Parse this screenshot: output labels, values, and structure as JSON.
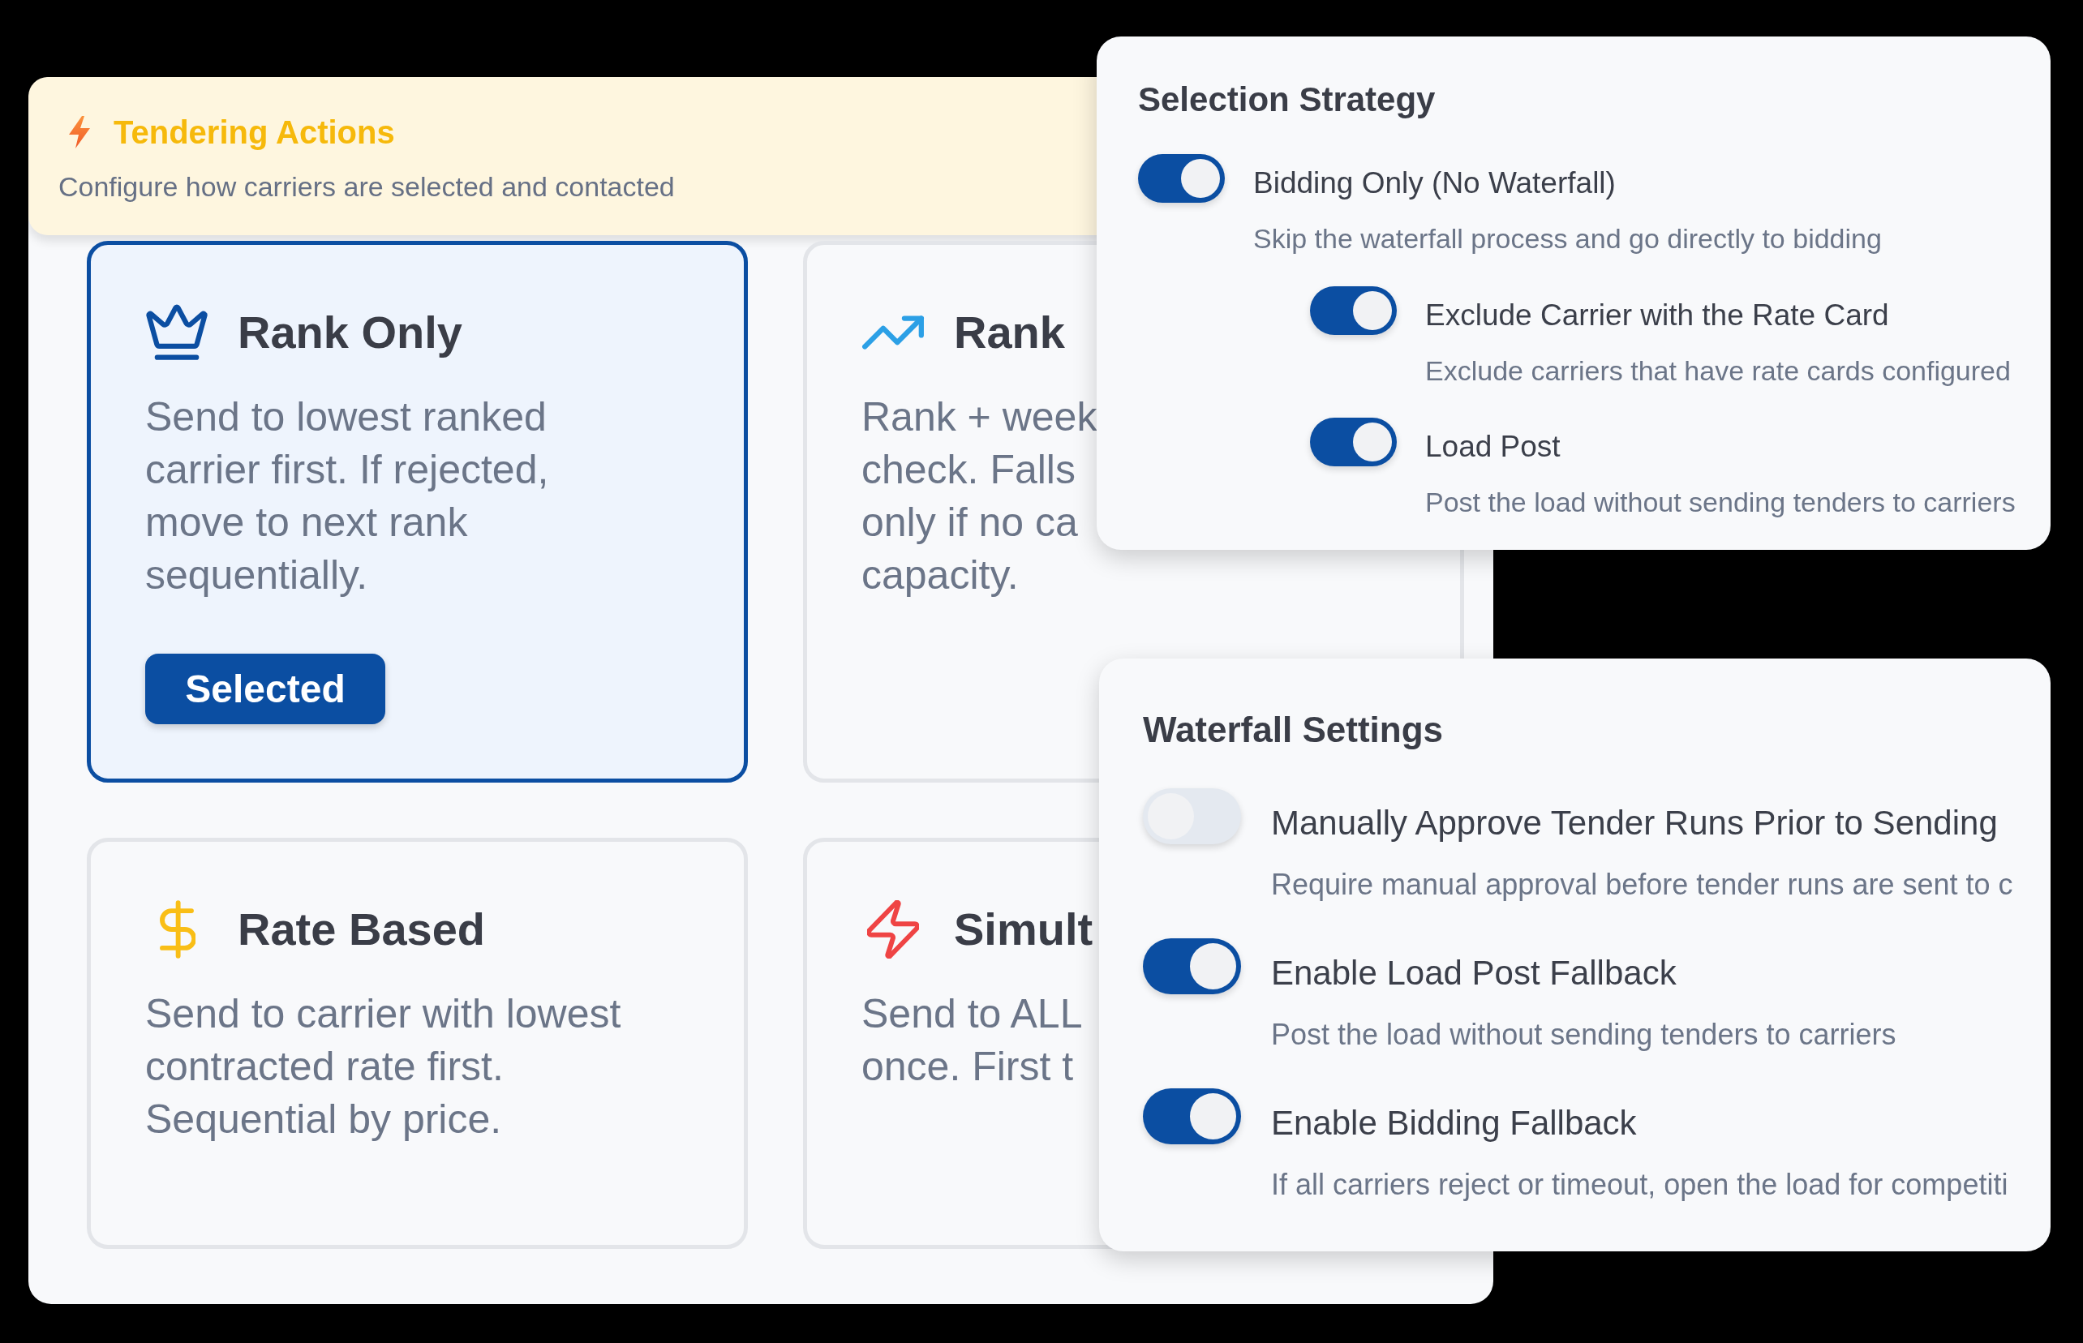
{
  "header": {
    "title": "Tendering Actions",
    "subtitle": "Configure how carriers are selected and contacted"
  },
  "strategy_cards": [
    {
      "title": "Rank Only",
      "description_lines": [
        "Send to lowest ranked",
        "carrier first. If rejected,",
        "move to next rank",
        "sequentially."
      ],
      "selected": true,
      "button": "Selected"
    },
    {
      "title": "Rank",
      "description_lines": [
        "Rank + week",
        "check. Falls",
        "only if no ca",
        "capacity."
      ],
      "selected": false
    },
    {
      "title": "Rate Based",
      "description_lines": [
        "Send to carrier with lowest",
        "contracted rate first.",
        "Sequential by price."
      ],
      "selected": false
    },
    {
      "title": "Simult",
      "description_lines": [
        "Send to ALL",
        "once. First t"
      ],
      "selected": false
    }
  ],
  "selection_strategy": {
    "title": "Selection Strategy",
    "options": [
      {
        "label": "Bidding Only (No Waterfall)",
        "description": "Skip the waterfall process and go directly to bidding",
        "on": true,
        "children": [
          {
            "label": "Exclude Carrier with the Rate Card",
            "description": "Exclude carriers that have rate cards configured",
            "on": true
          },
          {
            "label": "Load Post",
            "description": "Post the load without sending tenders to carriers",
            "on": true
          }
        ]
      }
    ]
  },
  "waterfall_settings": {
    "title": "Waterfall Settings",
    "options": [
      {
        "label": "Manually Approve Tender Runs Prior to Sending",
        "description": "Require manual approval before tender runs are sent to c",
        "on": false
      },
      {
        "label": "Enable Load Post Fallback",
        "description": "Post the load without sending tenders to carriers",
        "on": true
      },
      {
        "label": "Enable Bidding Fallback",
        "description": "If all carriers reject or timeout, open the load for competiti",
        "on": true
      }
    ]
  }
}
